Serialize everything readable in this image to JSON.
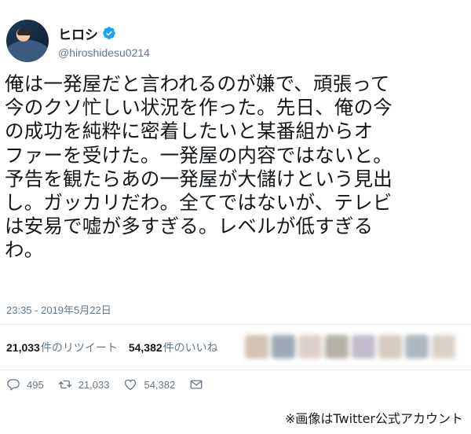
{
  "tweet": {
    "display_name": "ヒロシ",
    "handle": "@hiroshidesu0214",
    "verified_icon": "verified-badge-icon",
    "text_lines": [
      "俺は一発屋だと言われるのが嫌で、頑張って",
      "今のクソ忙しい状況を作った。先日、俺の今",
      "の成功を純粋に密着したいと某番組からオ",
      "ファーを受けた。一発屋の内容ではないと。",
      "予告を観たらあの一発屋が大儲けという見出",
      "し。ガッカリだわ。全てではないが、テレビ",
      "は安易で嘘が多すぎる。レベルが低すぎる",
      "わ。"
    ],
    "timestamp": "23:35 - 2019年5月22日"
  },
  "stats": {
    "retweet_count": "21,033",
    "retweet_label": "件のリツイート",
    "like_count": "54,382",
    "like_label": "件のいいね"
  },
  "actions": {
    "reply_count": "495",
    "retweet_count": "21,033",
    "like_count": "54,382",
    "reply_icon": "reply-icon",
    "retweet_icon": "retweet-icon",
    "like_icon": "heart-icon",
    "dm_icon": "envelope-icon"
  },
  "caption": "※画像はTwitter公式アカウント",
  "colors": {
    "text": "#14171a",
    "secondary": "#657786",
    "verified": "#1da1f2",
    "divider": "#e6ecf0"
  }
}
